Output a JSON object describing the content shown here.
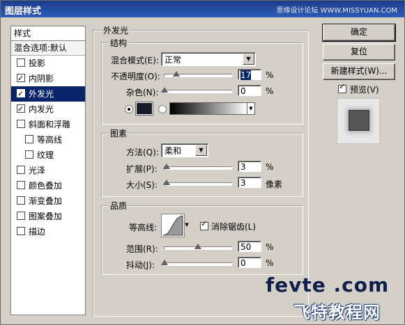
{
  "window": {
    "title": "图层样式",
    "watermark": "思缘设计论坛  WWW.MISSYUAN.COM"
  },
  "sidebar": {
    "header": "样式",
    "blend_options": "混合选项:默认",
    "items": [
      {
        "label": "投影",
        "checked": false,
        "sub": false,
        "selected": false
      },
      {
        "label": "内阴影",
        "checked": true,
        "sub": false,
        "selected": false
      },
      {
        "label": "外发光",
        "checked": true,
        "sub": false,
        "selected": true
      },
      {
        "label": "内发光",
        "checked": true,
        "sub": false,
        "selected": false
      },
      {
        "label": "斜面和浮雕",
        "checked": false,
        "sub": false,
        "selected": false
      },
      {
        "label": "等高线",
        "checked": false,
        "sub": true,
        "selected": false
      },
      {
        "label": "纹理",
        "checked": false,
        "sub": true,
        "selected": false
      },
      {
        "label": "光泽",
        "checked": false,
        "sub": false,
        "selected": false
      },
      {
        "label": "颜色叠加",
        "checked": false,
        "sub": false,
        "selected": false
      },
      {
        "label": "渐变叠加",
        "checked": false,
        "sub": false,
        "selected": false
      },
      {
        "label": "图案叠加",
        "checked": false,
        "sub": false,
        "selected": false
      },
      {
        "label": "描边",
        "checked": false,
        "sub": false,
        "selected": false
      }
    ]
  },
  "main": {
    "section_title": "外发光",
    "structure": {
      "title": "结构",
      "blend_mode_label": "混合模式(E):",
      "blend_mode_value": "正常",
      "opacity_label": "不透明度(O):",
      "opacity_value": "17",
      "opacity_unit": "%",
      "noise_label": "杂色(N):",
      "noise_value": "0",
      "noise_unit": "%",
      "color_swatch": "#171d28"
    },
    "elements": {
      "title": "图素",
      "method_label": "方法(Q):",
      "method_value": "柔和",
      "spread_label": "扩展(P):",
      "spread_value": "3",
      "spread_unit": "%",
      "size_label": "大小(S):",
      "size_value": "3",
      "size_unit": "像素"
    },
    "quality": {
      "title": "品质",
      "contour_label": "等高线:",
      "antialias_label": "消除锯齿(L)",
      "antialias_checked": true,
      "range_label": "范围(R):",
      "range_value": "50",
      "range_unit": "%",
      "jitter_label": "抖动(J):",
      "jitter_value": "0",
      "jitter_unit": "%"
    }
  },
  "buttons": {
    "ok": "确定",
    "reset": "复位",
    "new_style": "新建样式(W)...",
    "preview_label": "预览(V)",
    "preview_checked": true
  },
  "watermark_site": {
    "line1": "fevte .com",
    "line2": "飞特教程网"
  }
}
